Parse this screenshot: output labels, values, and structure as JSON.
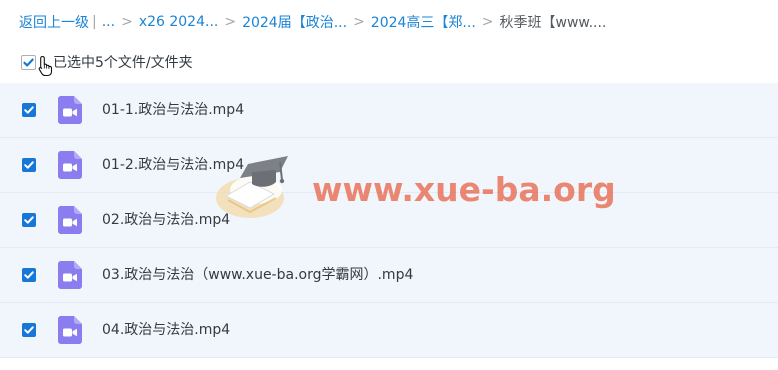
{
  "breadcrumb": {
    "back_label": "返回上一级",
    "pipe": "|",
    "ellipsis": "...",
    "items": [
      "x26 2024...",
      "2024届【政治...",
      "2024高三【郑...",
      "秋季班【www...."
    ],
    "separator": ">"
  },
  "selection": {
    "text": "已选中5个文件/文件夹",
    "checked": true
  },
  "files": [
    {
      "name": "01-1.政治与法治.mp4",
      "icon": "video-file-icon",
      "checked": true
    },
    {
      "name": "01-2.政治与法治.mp4",
      "icon": "video-file-icon",
      "checked": true
    },
    {
      "name": "02.政治与法治.mp4",
      "icon": "video-file-icon",
      "checked": true
    },
    {
      "name": "03.政治与法治（www.xue-ba.org学霸网）.mp4",
      "icon": "video-file-icon",
      "checked": true
    },
    {
      "name": "04.政治与法治.mp4",
      "icon": "video-file-icon",
      "checked": true
    }
  ],
  "watermark": {
    "text": "www.xue-ba.org"
  },
  "colors": {
    "accent": "#1677d8",
    "link": "#1a84d6",
    "row_bg": "#f1f6fc",
    "video_icon": "#8b7cf0",
    "watermark": "#e85c3e"
  }
}
